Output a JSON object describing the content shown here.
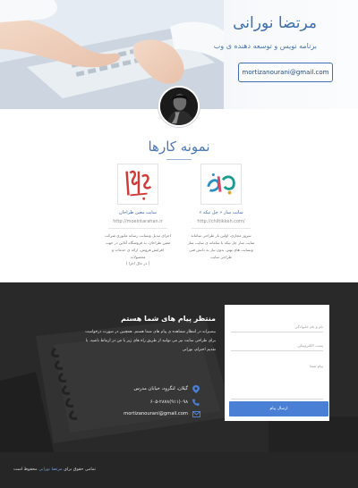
{
  "hero": {
    "name": "مرتضا نورانی",
    "subtitle": "برنامه نویس و توسعه دهنده ی وب",
    "email_button": "mortizanourani@gmail.com"
  },
  "portfolio": {
    "title": "نمونه کارها",
    "items": [
      {
        "title": "سایت ساز « چل تیکه »",
        "url": "http://chiltikkeh.com/",
        "desc": "سرور مجازی، اولین بار طراحی سامانه سایت ساز چل تیکه با سامانه ی سایت ساز وبسایت های بهتر، بدون نیاز به دانش فنی طراحی سایت",
        "more": ""
      },
      {
        "title": "سایت معین طراحان",
        "url": "http://moeintarahan.ir",
        "desc": "اجرای تبدیل وبسایت رسانه مانوری شرکت معین طراحان، به فروشگاه آنلاین در جهت افزایش فروش، ارائه ی خدمات و محصولات",
        "more": "( در حال اجرا )"
      }
    ]
  },
  "contact": {
    "title": "منتظر پیام های شما هستم",
    "text": "بیصبرانه در انتظار مشاهده ی پیام های شما هستم. همچنین در صورت درخواست برای طراحی سایت نیز می توانید از طریق راه های زیر با من در ارتباط باشید. با تقدیم احترام، نورانی",
    "address": "گیلان، لنگرود، خیابان مدرس",
    "phone": "۰۹۸(۹۱۱)۶۰۵-۲۸۷۸",
    "email": "mortizanourani@gmail.com",
    "form": {
      "name_placeholder": "نام و نام خانوادگی",
      "email_placeholder": "پست الکترونیکی",
      "message_placeholder": "پیام شما",
      "submit": "ارسال پیام"
    }
  },
  "footer": {
    "prefix": "تمامی حقوق برای",
    "owner": "مرتضا نورانی",
    "suffix": "محفوظ است"
  },
  "colors": {
    "accent": "#4a7fd6",
    "title_blue": "#3d6fb0",
    "dark_bg": "#262626"
  }
}
